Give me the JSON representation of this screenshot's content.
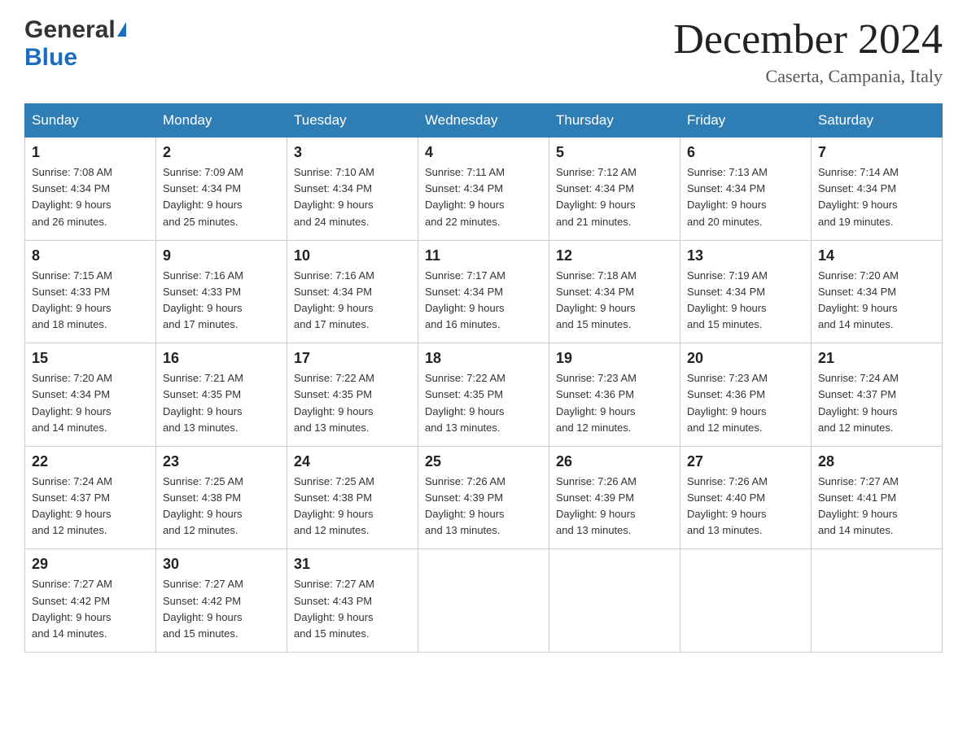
{
  "header": {
    "logo_general": "General",
    "logo_blue": "Blue",
    "month_title": "December 2024",
    "location": "Caserta, Campania, Italy"
  },
  "days_of_week": [
    "Sunday",
    "Monday",
    "Tuesday",
    "Wednesday",
    "Thursday",
    "Friday",
    "Saturday"
  ],
  "weeks": [
    [
      {
        "day": "1",
        "sunrise": "7:08 AM",
        "sunset": "4:34 PM",
        "daylight": "9 hours and 26 minutes."
      },
      {
        "day": "2",
        "sunrise": "7:09 AM",
        "sunset": "4:34 PM",
        "daylight": "9 hours and 25 minutes."
      },
      {
        "day": "3",
        "sunrise": "7:10 AM",
        "sunset": "4:34 PM",
        "daylight": "9 hours and 24 minutes."
      },
      {
        "day": "4",
        "sunrise": "7:11 AM",
        "sunset": "4:34 PM",
        "daylight": "9 hours and 22 minutes."
      },
      {
        "day": "5",
        "sunrise": "7:12 AM",
        "sunset": "4:34 PM",
        "daylight": "9 hours and 21 minutes."
      },
      {
        "day": "6",
        "sunrise": "7:13 AM",
        "sunset": "4:34 PM",
        "daylight": "9 hours and 20 minutes."
      },
      {
        "day": "7",
        "sunrise": "7:14 AM",
        "sunset": "4:34 PM",
        "daylight": "9 hours and 19 minutes."
      }
    ],
    [
      {
        "day": "8",
        "sunrise": "7:15 AM",
        "sunset": "4:33 PM",
        "daylight": "9 hours and 18 minutes."
      },
      {
        "day": "9",
        "sunrise": "7:16 AM",
        "sunset": "4:33 PM",
        "daylight": "9 hours and 17 minutes."
      },
      {
        "day": "10",
        "sunrise": "7:16 AM",
        "sunset": "4:34 PM",
        "daylight": "9 hours and 17 minutes."
      },
      {
        "day": "11",
        "sunrise": "7:17 AM",
        "sunset": "4:34 PM",
        "daylight": "9 hours and 16 minutes."
      },
      {
        "day": "12",
        "sunrise": "7:18 AM",
        "sunset": "4:34 PM",
        "daylight": "9 hours and 15 minutes."
      },
      {
        "day": "13",
        "sunrise": "7:19 AM",
        "sunset": "4:34 PM",
        "daylight": "9 hours and 15 minutes."
      },
      {
        "day": "14",
        "sunrise": "7:20 AM",
        "sunset": "4:34 PM",
        "daylight": "9 hours and 14 minutes."
      }
    ],
    [
      {
        "day": "15",
        "sunrise": "7:20 AM",
        "sunset": "4:34 PM",
        "daylight": "9 hours and 14 minutes."
      },
      {
        "day": "16",
        "sunrise": "7:21 AM",
        "sunset": "4:35 PM",
        "daylight": "9 hours and 13 minutes."
      },
      {
        "day": "17",
        "sunrise": "7:22 AM",
        "sunset": "4:35 PM",
        "daylight": "9 hours and 13 minutes."
      },
      {
        "day": "18",
        "sunrise": "7:22 AM",
        "sunset": "4:35 PM",
        "daylight": "9 hours and 13 minutes."
      },
      {
        "day": "19",
        "sunrise": "7:23 AM",
        "sunset": "4:36 PM",
        "daylight": "9 hours and 12 minutes."
      },
      {
        "day": "20",
        "sunrise": "7:23 AM",
        "sunset": "4:36 PM",
        "daylight": "9 hours and 12 minutes."
      },
      {
        "day": "21",
        "sunrise": "7:24 AM",
        "sunset": "4:37 PM",
        "daylight": "9 hours and 12 minutes."
      }
    ],
    [
      {
        "day": "22",
        "sunrise": "7:24 AM",
        "sunset": "4:37 PM",
        "daylight": "9 hours and 12 minutes."
      },
      {
        "day": "23",
        "sunrise": "7:25 AM",
        "sunset": "4:38 PM",
        "daylight": "9 hours and 12 minutes."
      },
      {
        "day": "24",
        "sunrise": "7:25 AM",
        "sunset": "4:38 PM",
        "daylight": "9 hours and 12 minutes."
      },
      {
        "day": "25",
        "sunrise": "7:26 AM",
        "sunset": "4:39 PM",
        "daylight": "9 hours and 13 minutes."
      },
      {
        "day": "26",
        "sunrise": "7:26 AM",
        "sunset": "4:39 PM",
        "daylight": "9 hours and 13 minutes."
      },
      {
        "day": "27",
        "sunrise": "7:26 AM",
        "sunset": "4:40 PM",
        "daylight": "9 hours and 13 minutes."
      },
      {
        "day": "28",
        "sunrise": "7:27 AM",
        "sunset": "4:41 PM",
        "daylight": "9 hours and 14 minutes."
      }
    ],
    [
      {
        "day": "29",
        "sunrise": "7:27 AM",
        "sunset": "4:42 PM",
        "daylight": "9 hours and 14 minutes."
      },
      {
        "day": "30",
        "sunrise": "7:27 AM",
        "sunset": "4:42 PM",
        "daylight": "9 hours and 15 minutes."
      },
      {
        "day": "31",
        "sunrise": "7:27 AM",
        "sunset": "4:43 PM",
        "daylight": "9 hours and 15 minutes."
      },
      null,
      null,
      null,
      null
    ]
  ],
  "labels": {
    "sunrise": "Sunrise:",
    "sunset": "Sunset:",
    "daylight": "Daylight:"
  }
}
